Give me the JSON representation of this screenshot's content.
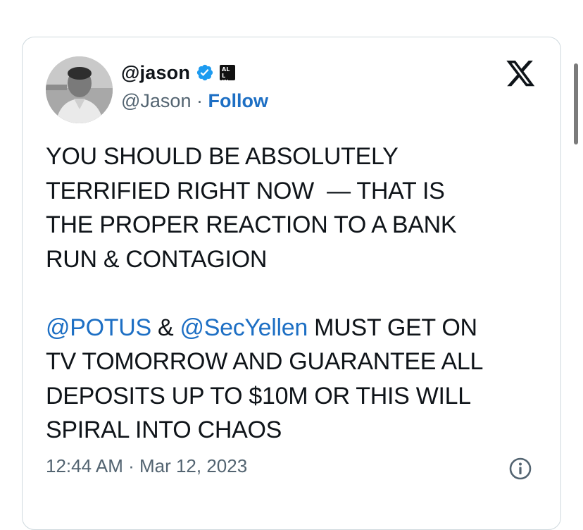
{
  "author": {
    "display_name": "@jason",
    "handle": "@Jason",
    "separator": " · ",
    "follow_label": "Follow",
    "affiliation_badge": "ALL IN",
    "verified_color": "#1d9bf0"
  },
  "tweet": {
    "paragraph1": [
      "YOU SHOULD BE ABSOLUTELY",
      "TERRIFIED RIGHT NOW  — THAT IS",
      "THE PROPER REACTION TO A BANK",
      "RUN & CONTAGION"
    ],
    "mention1": "@POTUS",
    "amp": " & ",
    "mention2": "@SecYellen",
    "line5_rest": " MUST GET ON",
    "paragraph2_rest": [
      "TV TOMORROW AND GUARANTEE ALL",
      "DEPOSITS UP TO $10M OR THIS WILL",
      "SPIRAL INTO CHAOS"
    ],
    "timestamp": "12:44 AM · Mar 12, 2023"
  },
  "icons": {
    "platform": "x-logo-icon",
    "verified": "verified-badge-icon",
    "info": "info-icon"
  },
  "colors": {
    "text": "#0f1419",
    "secondary": "#536471",
    "link": "#1d6fc4",
    "border": "#cfd9de"
  }
}
